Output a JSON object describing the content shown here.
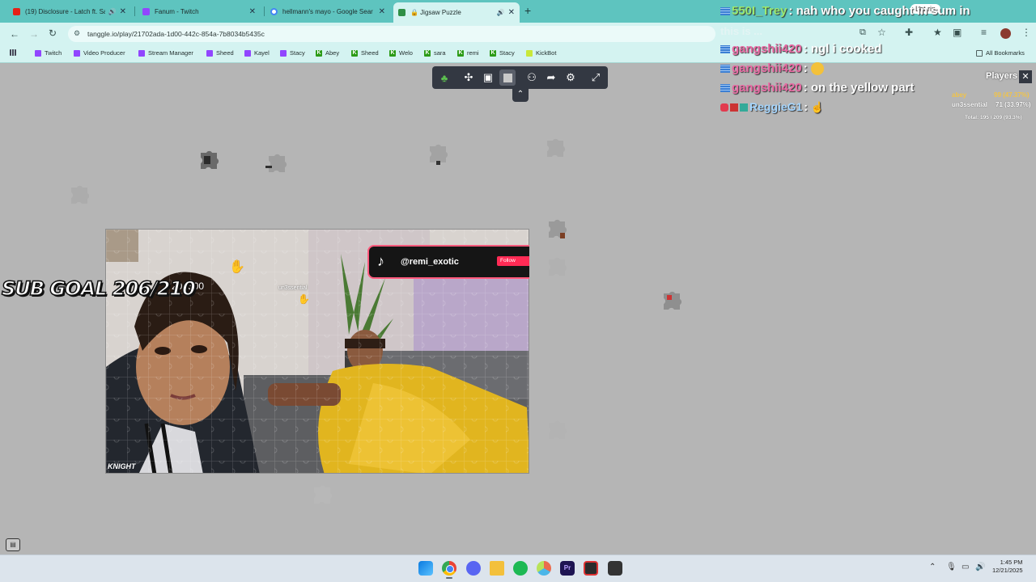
{
  "browser": {
    "tabs": [
      {
        "label": "(19) Disclosure - Latch ft. Sa",
        "icon": "youtube-icon",
        "color": "#e62117",
        "audio": true
      },
      {
        "label": "Fanum - Twitch",
        "icon": "twitch-icon",
        "color": "#9146ff",
        "audio": false
      },
      {
        "label": "hellmann's mayo - Google Sear",
        "icon": "google-icon",
        "color": "#4285f4",
        "audio": false
      },
      {
        "label": "🔒 Jigsaw Puzzle",
        "icon": "tanggle-icon",
        "color": "#2f8f46",
        "audio": true,
        "active": true
      }
    ],
    "url": "tanggle.io/play/21702ada-1d00-442c-854a-7b8034b5435c",
    "bookmarks": [
      {
        "label": "Twitch",
        "type": "twitch"
      },
      {
        "label": "Video Producer",
        "type": "twitch"
      },
      {
        "label": "Stream Manager",
        "type": "twitch"
      },
      {
        "label": "Sheed",
        "type": "twitch"
      },
      {
        "label": "Kayel",
        "type": "twitch"
      },
      {
        "label": "Stacy",
        "type": "twitch"
      },
      {
        "label": "Abey",
        "type": "kick"
      },
      {
        "label": "Sheed",
        "type": "kick"
      },
      {
        "label": "Welo",
        "type": "kick"
      },
      {
        "label": "sara",
        "type": "kick"
      },
      {
        "label": "remi",
        "type": "kick"
      },
      {
        "label": "Stacy",
        "type": "kick"
      },
      {
        "label": "KickBot",
        "type": "kickbot"
      }
    ],
    "all_bookmarks": "All Bookmarks"
  },
  "game": {
    "tiktok_handle": "@remi_exotic",
    "tiktok_follow": "Follow",
    "cursor_user": "un3ssential",
    "partial_goal_text": "20 /500",
    "brand_text": "KNIGHT"
  },
  "stream_overlay": {
    "sub_goal": "SUB GOAL 206/210",
    "overlay_pill": "Let rip",
    "faded_line": "this is ...",
    "chat": [
      {
        "user": "550I_Trey",
        "message": "nah who you caught in sum in",
        "color": "#9be870"
      },
      {
        "user": "gangshii420",
        "message": "ngl i cooked",
        "color": "#ea6aa4"
      },
      {
        "user": "gangshii420",
        "message": "",
        "emoji": "face-emoji",
        "color": "#ea6aa4"
      },
      {
        "user": "gangshii420",
        "message": "on the yellow part",
        "color": "#ea6aa4"
      },
      {
        "user": "ReggieG1",
        "message": "",
        "emoji": "hand-emoji",
        "color": "#a5d6ff"
      }
    ],
    "players": {
      "title": "Players",
      "rows": [
        {
          "name": "abey",
          "score": "99 (47.37%)"
        },
        {
          "name": "un3ssential",
          "score": "71 (33.97%)"
        }
      ],
      "total": "Total: 195 / 209 (93.3%)"
    }
  },
  "taskbar": {
    "time": "1:45 PM",
    "date": "12/21/2025"
  }
}
